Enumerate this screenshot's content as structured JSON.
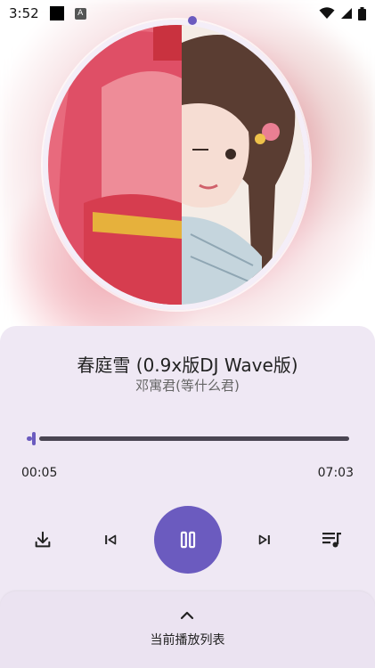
{
  "status_bar": {
    "time": "3:52",
    "a_badge": "A"
  },
  "song": {
    "title": "春庭雪 (0.9x版DJ Wave版)",
    "artist": "邓寓君(等什么君)"
  },
  "playback": {
    "current_time": "00:05",
    "total_time": "07:03",
    "progress_fraction": 0.012,
    "is_playing": true
  },
  "queue": {
    "label": "当前播放列表"
  },
  "colors": {
    "accent": "#6b5bbf",
    "panel_bg": "#efe8f4",
    "track": "#4a4552"
  },
  "icons": {
    "download": "download-icon",
    "previous": "skip-previous-icon",
    "pause": "pause-icon",
    "next": "skip-next-icon",
    "playlist": "playlist-icon",
    "chevron": "chevron-up-icon",
    "wifi": "wifi-icon",
    "cellular": "cellular-signal-icon",
    "battery": "battery-icon"
  }
}
